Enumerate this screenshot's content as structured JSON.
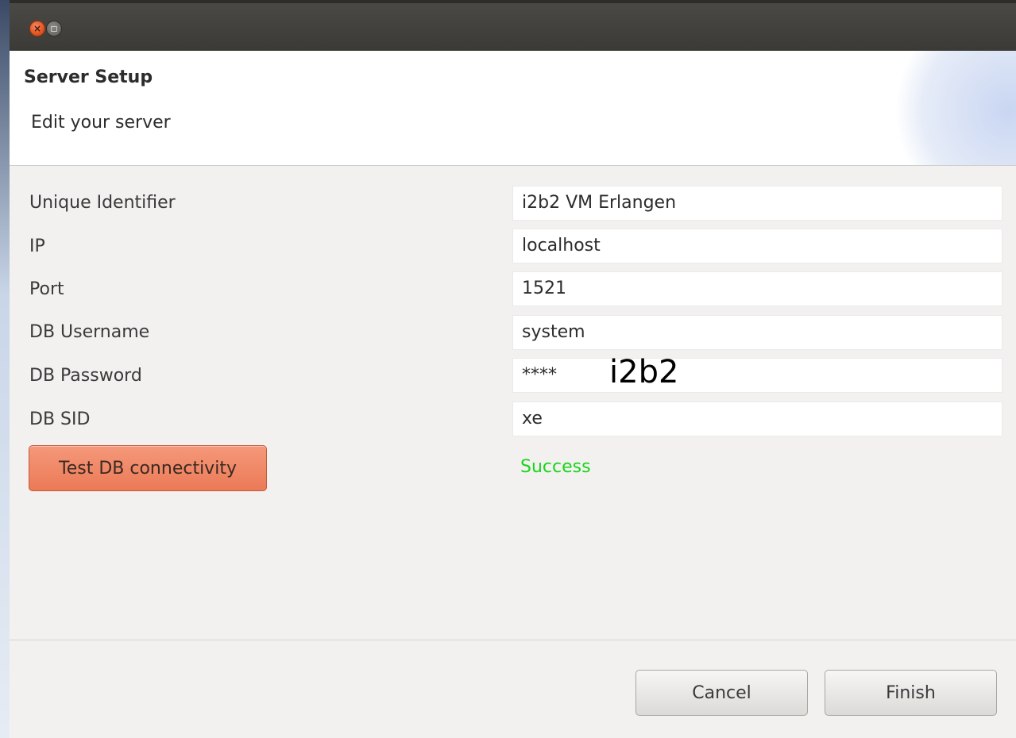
{
  "window": {
    "close_glyph": "×",
    "title_bar_text": ""
  },
  "header": {
    "title": "Server Setup",
    "subtitle": "Edit your server"
  },
  "form": {
    "rows": [
      {
        "label": "Unique Identifier",
        "value": "i2b2 VM Erlangen"
      },
      {
        "label": "IP",
        "value": "localhost"
      },
      {
        "label": "Port",
        "value": "1521"
      },
      {
        "label": "DB Username",
        "value": "system"
      },
      {
        "label": "DB Password",
        "value": "****"
      },
      {
        "label": "DB SID",
        "value": "xe"
      }
    ],
    "test_button_label": "Test DB connectivity",
    "status_text": "Success",
    "password_annotation": "i2b2"
  },
  "footer": {
    "cancel_label": "Cancel",
    "finish_label": "Finish"
  },
  "colors": {
    "titlebar": "#3b3a36",
    "test_button": "#ec7a56",
    "success": "#19d419",
    "dialog_background": "#f2f1f0"
  },
  "icons": {
    "close": "close-icon",
    "maximize": "maximize-icon"
  }
}
